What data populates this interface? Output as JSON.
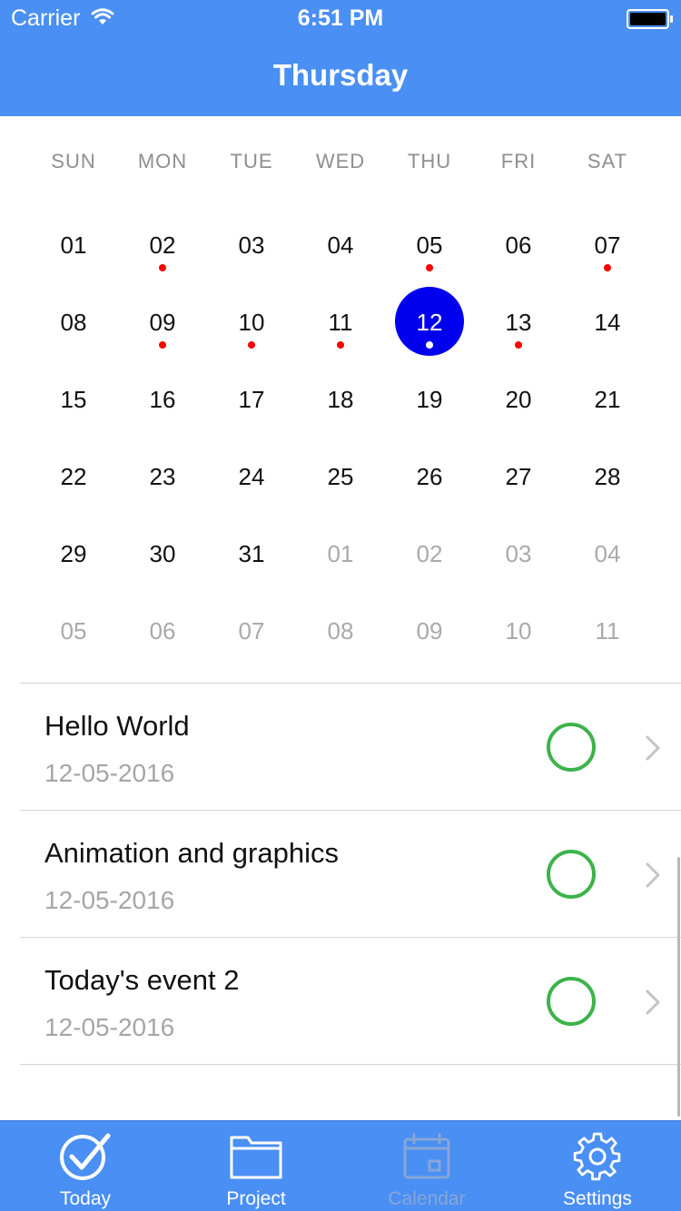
{
  "status_bar": {
    "carrier": "Carrier",
    "time": "6:51 PM"
  },
  "header": {
    "title": "Thursday"
  },
  "calendar": {
    "weekdays": [
      "SUN",
      "MON",
      "TUE",
      "WED",
      "THU",
      "FRI",
      "SAT"
    ],
    "weeks": [
      [
        "01",
        "02",
        "03",
        "04",
        "05",
        "06",
        "07"
      ],
      [
        "08",
        "09",
        "10",
        "11",
        "12",
        "13",
        "14"
      ],
      [
        "15",
        "16",
        "17",
        "18",
        "19",
        "20",
        "21"
      ],
      [
        "22",
        "23",
        "24",
        "25",
        "26",
        "27",
        "28"
      ],
      [
        "29",
        "30",
        "31",
        "01",
        "02",
        "03",
        "04"
      ],
      [
        "05",
        "06",
        "07",
        "08",
        "09",
        "10",
        "11"
      ]
    ],
    "selected_day": "12",
    "event_days": [
      "02",
      "05",
      "07",
      "09",
      "10",
      "11",
      "12",
      "13"
    ],
    "accent_color": "#0000ee",
    "event_dot_color": "#ff0000"
  },
  "events": [
    {
      "title": "Hello World",
      "date": "12-05-2016"
    },
    {
      "title": "Animation and graphics",
      "date": "12-05-2016"
    },
    {
      "title": "Today's event 2",
      "date": "12-05-2016"
    }
  ],
  "tabbar": {
    "items": [
      {
        "label": "Today",
        "icon": "checkmark-circle-icon",
        "active": true
      },
      {
        "label": "Project",
        "icon": "folder-icon",
        "active": true
      },
      {
        "label": "Calendar",
        "icon": "calendar-icon",
        "active": false
      },
      {
        "label": "Settings",
        "icon": "gear-icon",
        "active": true
      }
    ],
    "background_color": "#4a8ff3"
  }
}
